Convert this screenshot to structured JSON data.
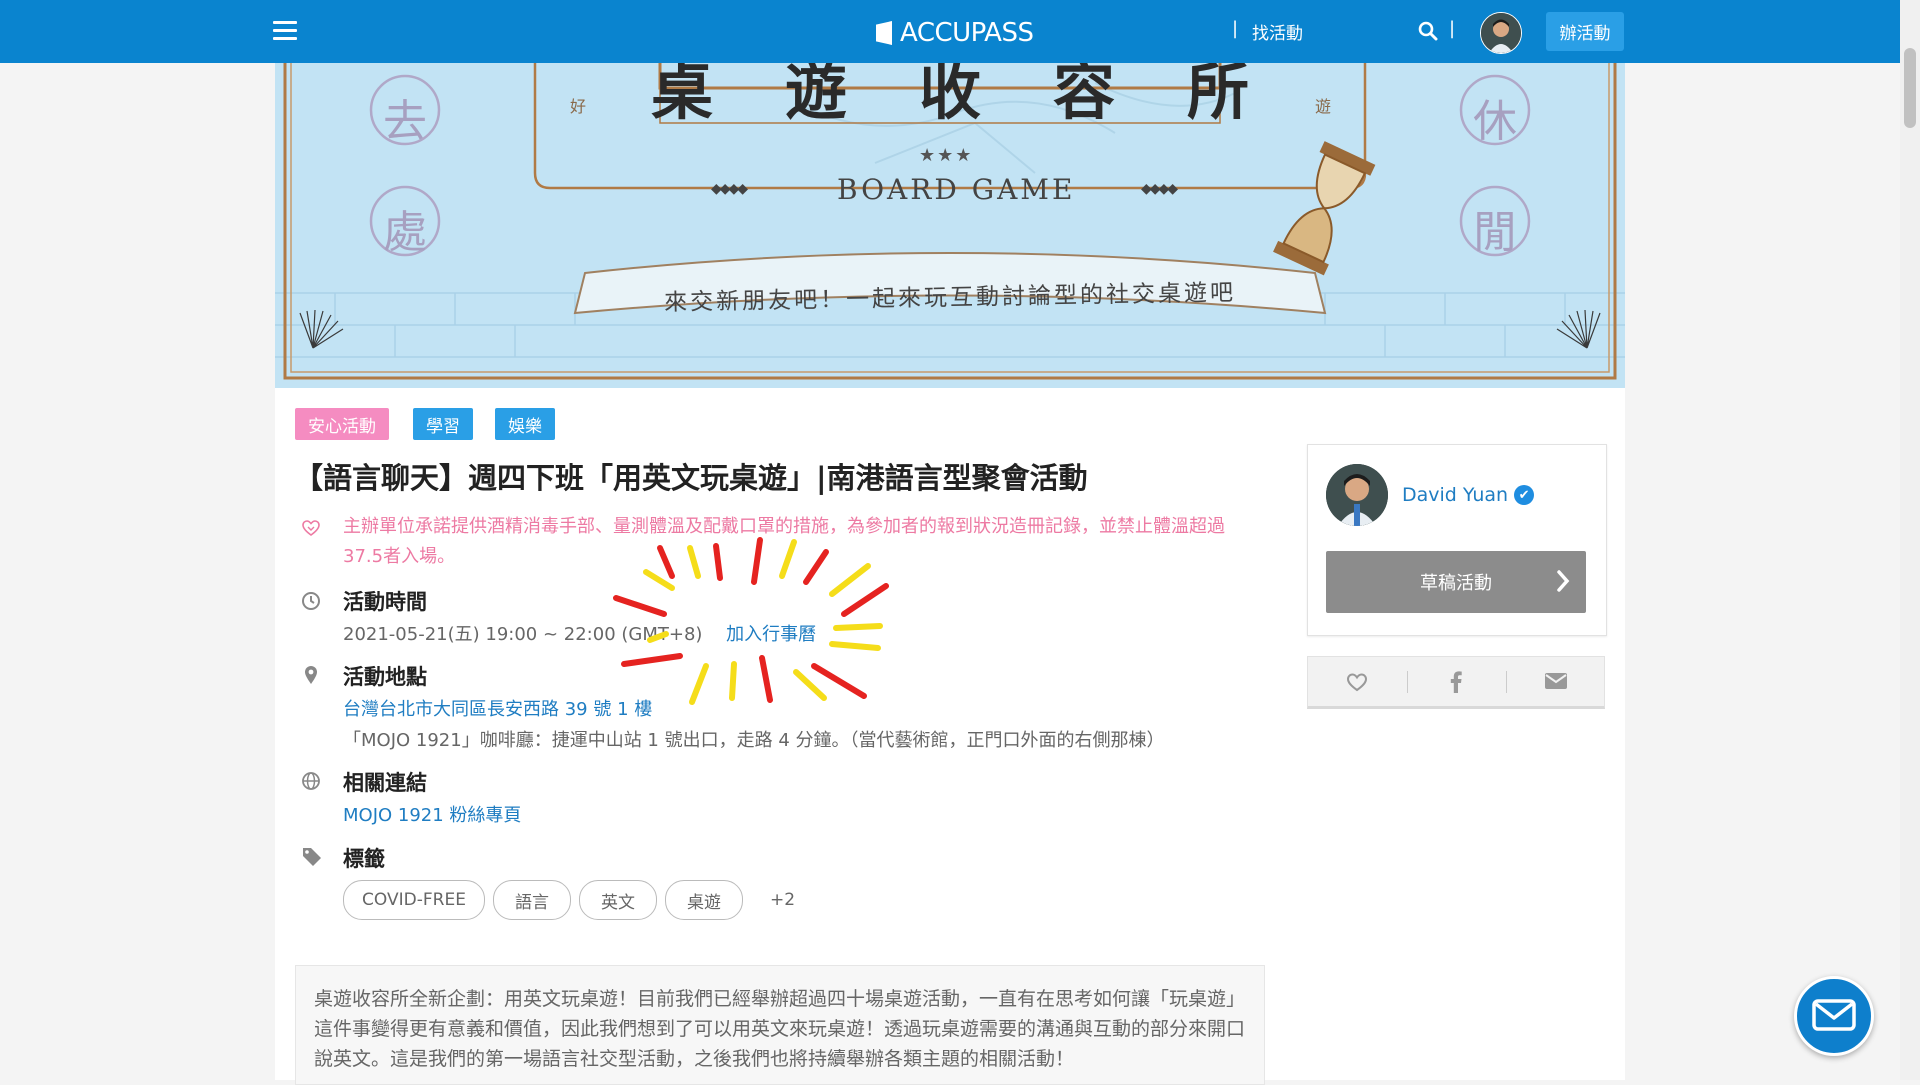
{
  "header": {
    "logo_text": "ACCUPASS",
    "nav_find": "找活動",
    "host_button": "辦活動"
  },
  "banner": {
    "title_chars": [
      "桌",
      "遊",
      "收",
      "容",
      "所"
    ],
    "left_seal": [
      "去",
      "處"
    ],
    "right_seal": [
      "休",
      "閒"
    ],
    "small_left": "好",
    "small_right": "遊",
    "stars": "★★★",
    "subtitle": "BOARD GAME",
    "deco": "◆◆◆◆",
    "ribbon": "來交新朋友吧！一起來玩互動討論型的社交桌遊吧"
  },
  "event": {
    "categories": [
      {
        "label": "安心活動",
        "color": "#f58cc1"
      },
      {
        "label": "學習",
        "color": "#2a9fe6"
      },
      {
        "label": "娛樂",
        "color": "#2a9fe6"
      }
    ],
    "title": "【語言聊天】週四下班「用英文玩桌遊」|南港語言型聚會活動",
    "covid_notice": "主辦單位承諾提供酒精消毒手部、量測體溫及配戴口罩的措施，為參加者的報到狀況造冊記錄，並禁止體溫超過37.5者入場。",
    "time_label": "活動時間",
    "time_value": "2021-05-21(五) 19:00 ~ 22:00 (GMT+8)",
    "add_calendar": "加入行事曆",
    "location_label": "活動地點",
    "address": "台灣台北市大同區長安西路 39 號 1 樓",
    "address_note": "「MOJO 1921」咖啡廳：捷運中山站 1 號出口，走路 4 分鐘。（當代藝術館，正門口外面的右側那棟）",
    "links_label": "相關連結",
    "link_text": "MOJO 1921 粉絲專頁",
    "tags_label": "標籤",
    "tags": [
      "COVID-FREE",
      "語言",
      "英文",
      "桌遊"
    ],
    "tags_more": "+2",
    "description": "桌遊收容所全新企劃：用英文玩桌遊！目前我們已經舉辦超過四十場桌遊活動，一直有在思考如何讓「玩桌遊」這件事變得更有意義和價值，因此我們想到了可以用英文來玩桌遊！透過玩桌遊需要的溝通與互動的部分來開口說英文。這是我們的第一場語言社交型活動，之後我們也將持續舉辦各類主題的相關活動！"
  },
  "sidebar": {
    "host_name": "David Yuan",
    "draft_button": "草稿活動"
  },
  "colors": {
    "brand": "#0a84cf",
    "link": "#1f7dc2",
    "covid": "#ed7aa3"
  }
}
